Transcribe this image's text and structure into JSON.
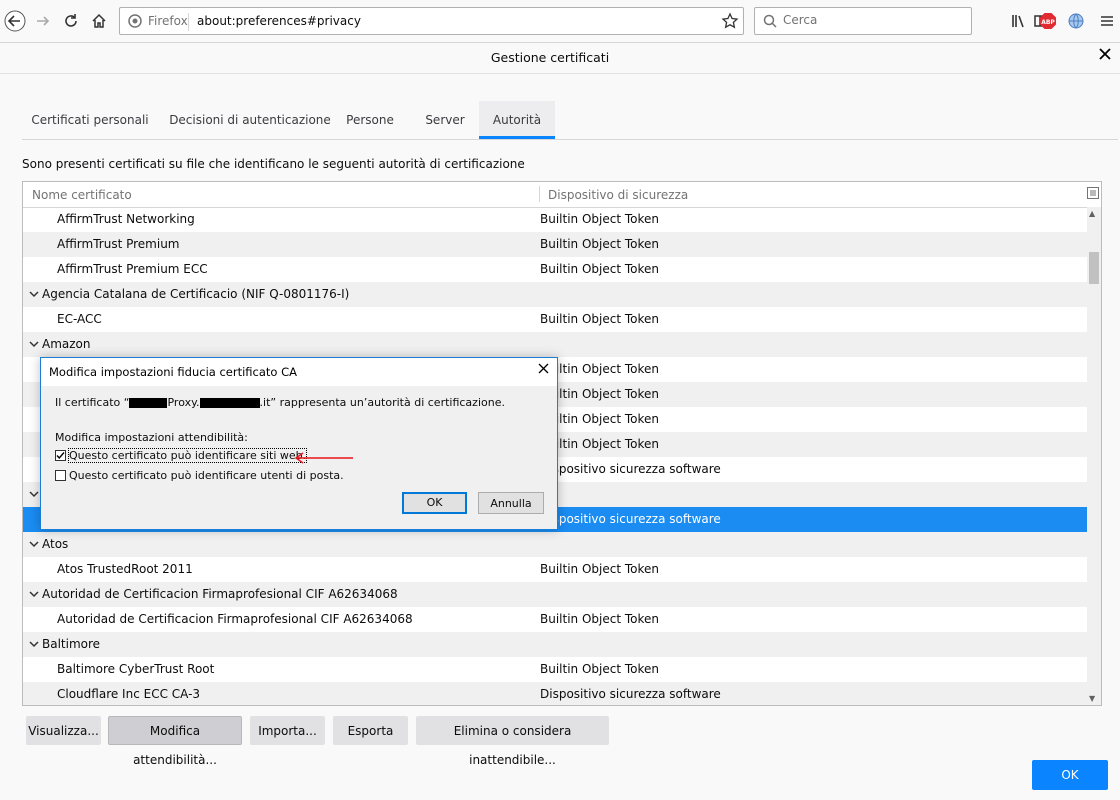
{
  "browser": {
    "identity_label": "Firefox",
    "url": "about:preferences#privacy",
    "search_placeholder": "Cerca"
  },
  "dialog": {
    "title": "Gestione certificati",
    "tabs": [
      "Certificati personali",
      "Decisioni di autenticazione",
      "Persone",
      "Server",
      "Autorità"
    ],
    "active_tab": "Autorità",
    "description": "Sono presenti certificati su file che identificano le seguenti autorità di certificazione",
    "columns": [
      "Nome certificato",
      "Dispositivo di sicurezza"
    ],
    "rows": [
      {
        "type": "item",
        "name": "AffirmTrust Networking",
        "device": "Builtin Object Token"
      },
      {
        "type": "item",
        "name": "AffirmTrust Premium",
        "device": "Builtin Object Token"
      },
      {
        "type": "item",
        "name": "AffirmTrust Premium ECC",
        "device": "Builtin Object Token"
      },
      {
        "type": "group",
        "name": "Agencia Catalana de Certificacio (NIF Q-0801176-I)",
        "device": ""
      },
      {
        "type": "item",
        "name": "EC-ACC",
        "device": "Builtin Object Token"
      },
      {
        "type": "group",
        "name": "Amazon",
        "device": ""
      },
      {
        "type": "item",
        "name": "",
        "device": "Builtin Object Token"
      },
      {
        "type": "item",
        "name": "",
        "device": "Builtin Object Token"
      },
      {
        "type": "item",
        "name": "",
        "device": "Builtin Object Token"
      },
      {
        "type": "item",
        "name": "",
        "device": "Builtin Object Token"
      },
      {
        "type": "item",
        "name": "",
        "device": "Dispositivo sicurezza software"
      },
      {
        "type": "group",
        "name": "",
        "device": ""
      },
      {
        "type": "item",
        "name": "",
        "device": "Dispositivo sicurezza software",
        "selected": true
      },
      {
        "type": "group",
        "name": "Atos",
        "device": ""
      },
      {
        "type": "item",
        "name": "Atos TrustedRoot 2011",
        "device": "Builtin Object Token"
      },
      {
        "type": "group",
        "name": "Autoridad de Certificacion Firmaprofesional CIF A62634068",
        "device": ""
      },
      {
        "type": "item",
        "name": "Autoridad de Certificacion Firmaprofesional CIF A62634068",
        "device": "Builtin Object Token"
      },
      {
        "type": "group",
        "name": "Baltimore",
        "device": ""
      },
      {
        "type": "item",
        "name": "Baltimore CyberTrust Root",
        "device": "Builtin Object Token"
      },
      {
        "type": "item",
        "name": "Cloudflare Inc ECC CA-3",
        "device": "Dispositivo sicurezza software"
      }
    ],
    "buttons": {
      "view": "Visualizza...",
      "edit_trust": "Modifica attendibilità...",
      "import": "Importa...",
      "export": "Esporta",
      "delete": "Elimina o considera inattendibile...",
      "ok": "OK"
    }
  },
  "modal": {
    "title": "Modifica impostazioni fiducia certificato CA",
    "msg_prefix": "Il certificato “",
    "msg_mid": "Proxy.",
    "msg_suffix": ".it” rappresenta un’autorità di certificazione.",
    "subtitle": "Modifica impostazioni attendibilità:",
    "check_web": {
      "label": "Questo certificato può identificare siti web.",
      "checked": true
    },
    "check_mail": {
      "label": "Questo certificato può identificare utenti di posta.",
      "checked": false
    },
    "ok": "OK",
    "cancel": "Annulla"
  },
  "annotation_color": "#e8121a",
  "accent": "#0a84ff"
}
